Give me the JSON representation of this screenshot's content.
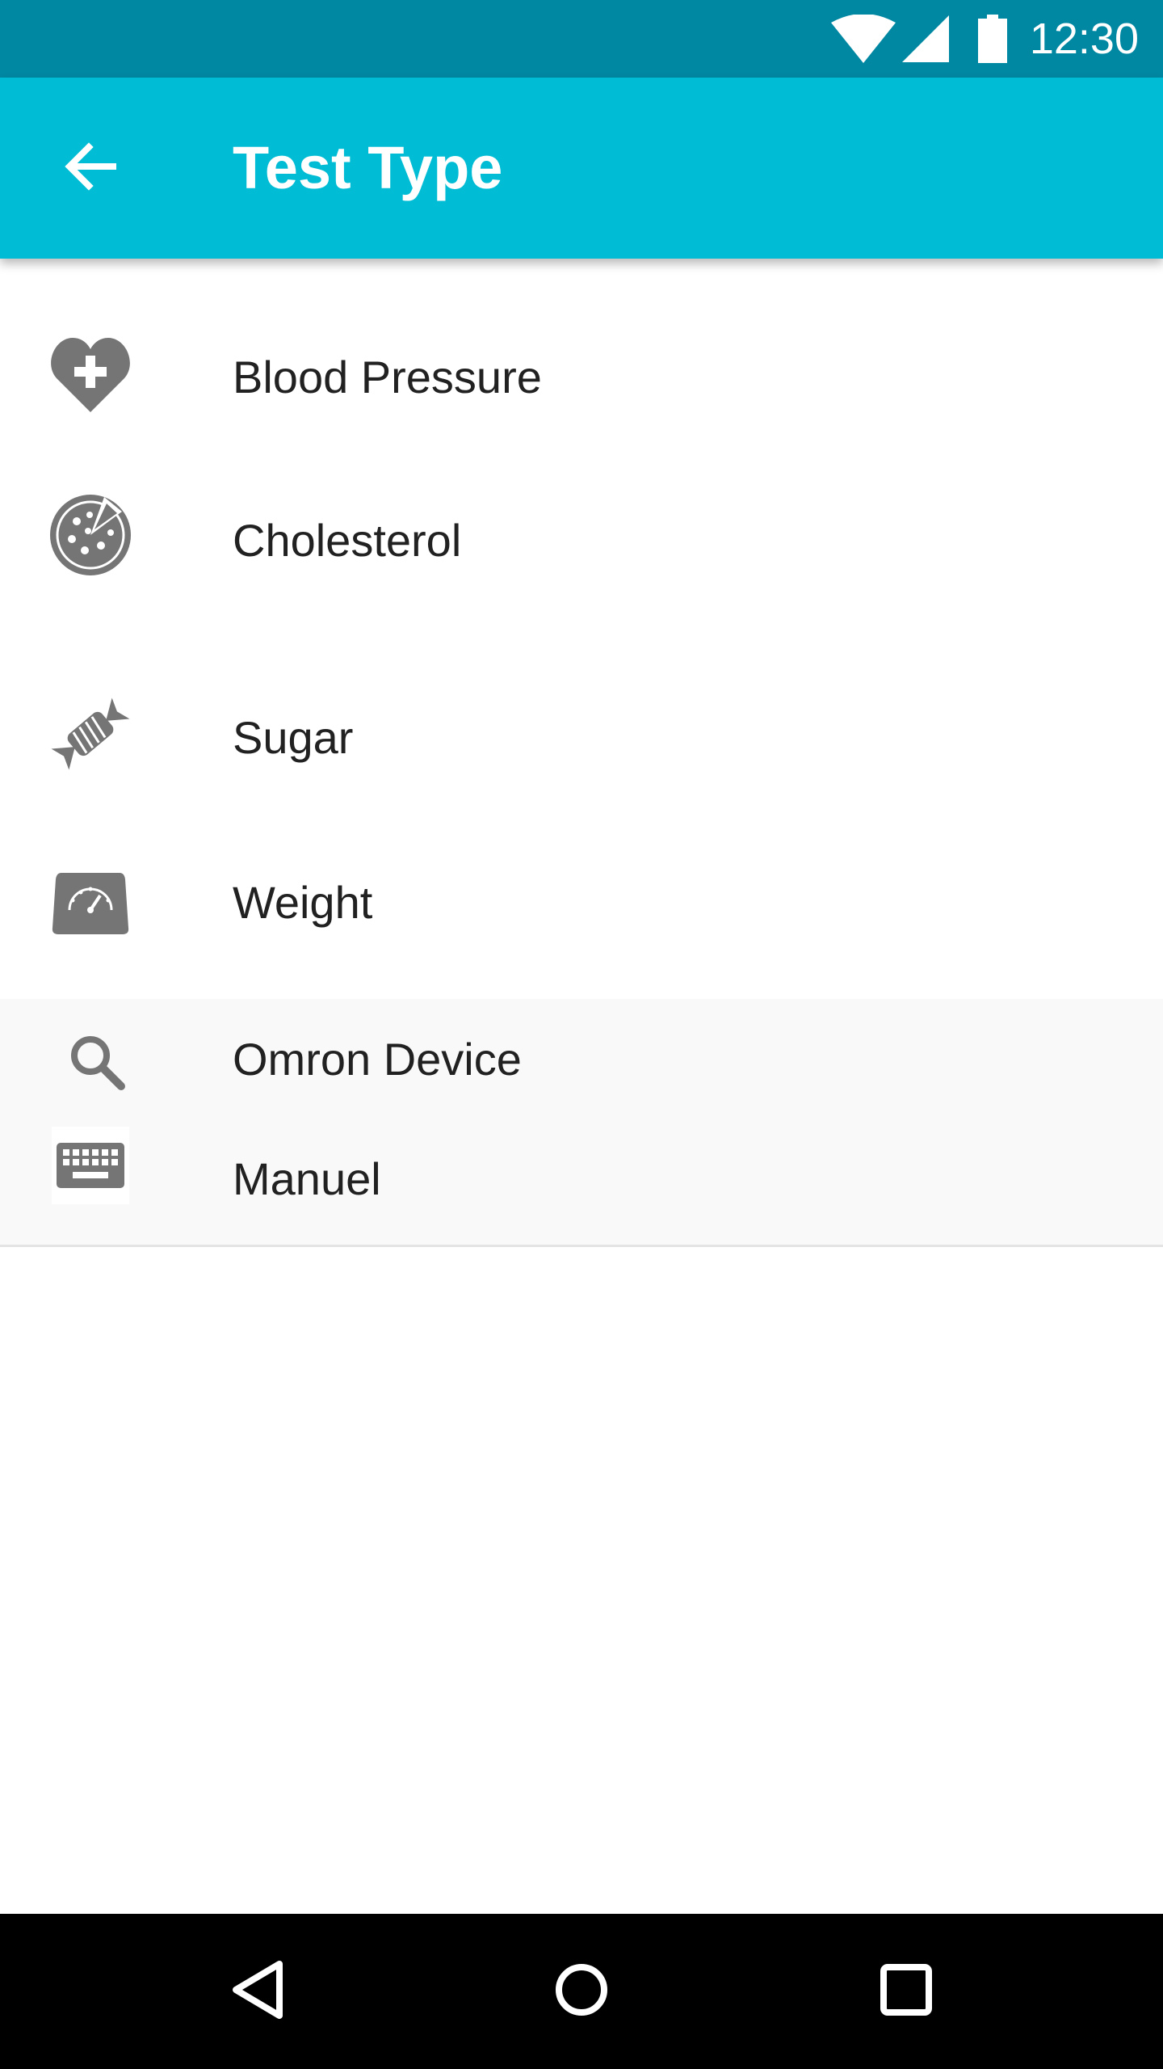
{
  "status_bar": {
    "time": "12:30",
    "background": "#0088a3",
    "icons": [
      "wifi-icon",
      "cell-signal-icon",
      "battery-icon"
    ]
  },
  "app_bar": {
    "title": "Test Type",
    "background": "#00bcd4",
    "back_icon": "arrow-back-icon"
  },
  "test_types": [
    {
      "label": "Blood Pressure",
      "icon": "heart-plus-icon"
    },
    {
      "label": "Cholesterol",
      "icon": "pizza-icon"
    },
    {
      "label": "Sugar",
      "icon": "candy-icon"
    },
    {
      "label": "Weight",
      "icon": "scale-icon"
    }
  ],
  "input_methods": [
    {
      "label": "Omron Device",
      "icon": "search-icon"
    },
    {
      "label": "Manuel",
      "icon": "keyboard-icon"
    }
  ],
  "nav_bar": {
    "icons": [
      "back-triangle-icon",
      "home-circle-icon",
      "recents-square-icon"
    ]
  },
  "colors": {
    "icon_gray": "#757575",
    "text": "#212121",
    "panel": "#f9f9f9"
  }
}
